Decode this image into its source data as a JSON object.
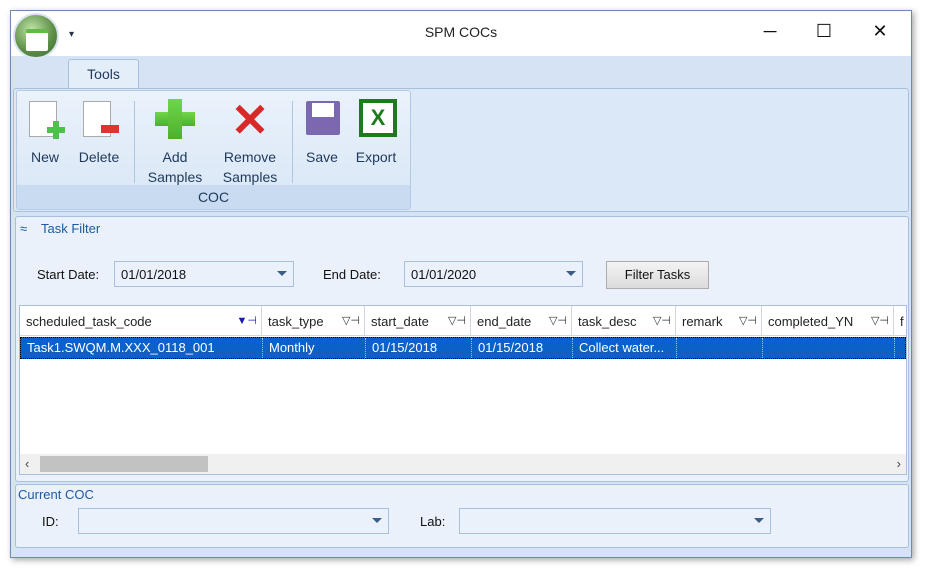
{
  "window": {
    "title": "SPM COCs",
    "qat_icon": "customize-arrow-icon",
    "controls": [
      "─",
      "☐",
      "✕"
    ]
  },
  "ribbon": {
    "tab": "Tools",
    "group_label": "COC",
    "buttons": [
      {
        "label": "New",
        "icon": "new-document-icon"
      },
      {
        "label": "Delete",
        "icon": "delete-document-icon"
      },
      {
        "label": "Add Samples",
        "icon": "green-plus-icon"
      },
      {
        "label": "Remove Samples",
        "icon": "red-x-icon"
      },
      {
        "label": "Save",
        "icon": "floppy-disk-icon"
      },
      {
        "label": "Export",
        "icon": "excel-icon"
      }
    ]
  },
  "task_filter": {
    "title": "Task Filter",
    "start_label": "Start Date:",
    "start_value": "01/01/2018",
    "end_label": "End Date:",
    "end_value": "01/01/2020",
    "filter_button": "Filter Tasks",
    "columns": [
      "scheduled_task_code",
      "task_type",
      "start_date",
      "end_date",
      "task_desc",
      "remark",
      "completed_YN",
      "f"
    ],
    "rows": [
      [
        "Task1.SWQM.M.XXX_0118_001",
        "Monthly",
        "01/15/2018",
        "01/15/2018",
        "Collect water...",
        "",
        ""
      ]
    ]
  },
  "current_coc": {
    "title": "Current COC",
    "id_label": "ID:",
    "id_value": "",
    "lab_label": "Lab:",
    "lab_value": ""
  }
}
